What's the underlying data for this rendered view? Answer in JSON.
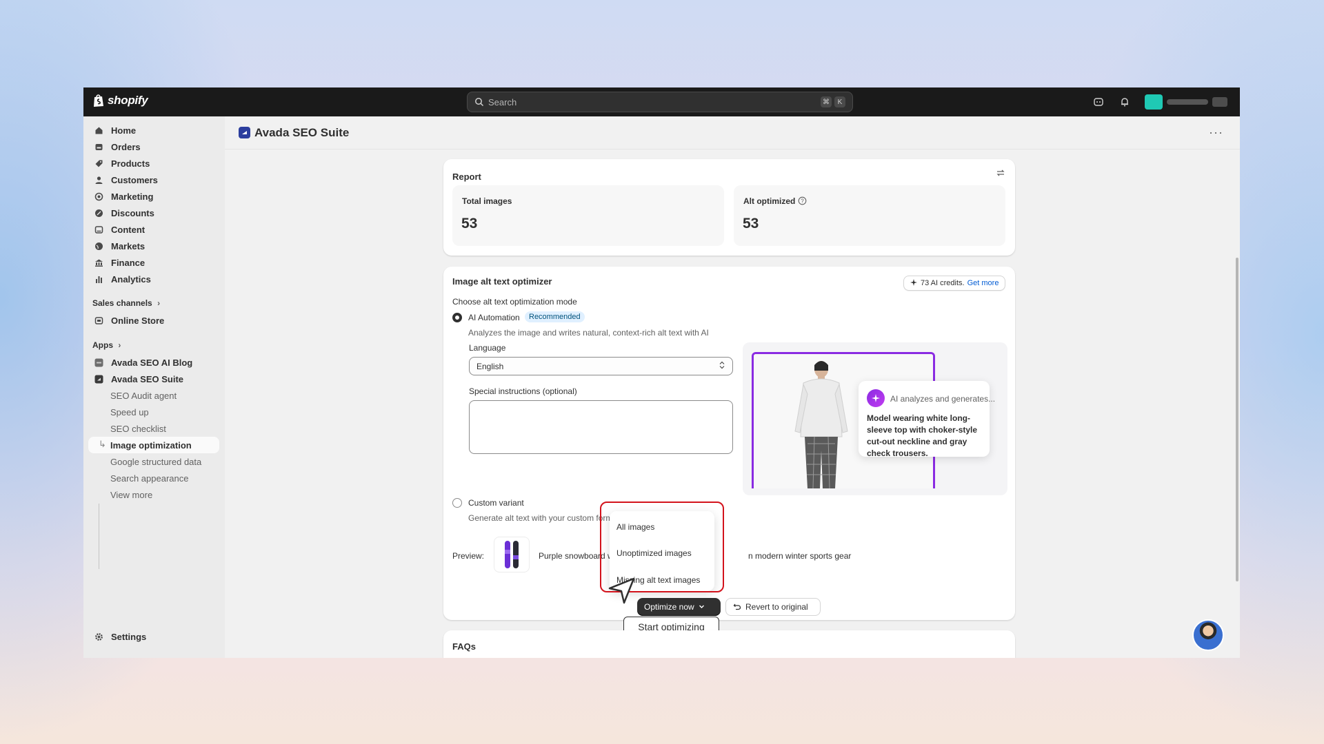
{
  "topbar": {
    "logo_text": "shopify",
    "search_placeholder": "Search",
    "kbd_cmd": "⌘",
    "kbd_key": "K"
  },
  "sidebar": {
    "items": [
      {
        "label": "Home",
        "icon": "home-icon"
      },
      {
        "label": "Orders",
        "icon": "inbox-icon"
      },
      {
        "label": "Products",
        "icon": "tag-icon"
      },
      {
        "label": "Customers",
        "icon": "person-icon"
      },
      {
        "label": "Marketing",
        "icon": "target-icon"
      },
      {
        "label": "Discounts",
        "icon": "discount-icon"
      },
      {
        "label": "Content",
        "icon": "content-icon"
      },
      {
        "label": "Markets",
        "icon": "globe-icon"
      },
      {
        "label": "Finance",
        "icon": "bank-icon"
      },
      {
        "label": "Analytics",
        "icon": "bar-chart-icon"
      }
    ],
    "sales_channels_label": "Sales channels",
    "online_store_label": "Online Store",
    "apps_label": "Apps",
    "apps": [
      {
        "label": "Avada SEO AI Blog"
      },
      {
        "label": "Avada SEO Suite"
      }
    ],
    "sub_items": [
      {
        "label": "SEO Audit agent"
      },
      {
        "label": "Speed up"
      },
      {
        "label": "SEO checklist"
      },
      {
        "label": "Image optimization"
      },
      {
        "label": "Google structured data"
      },
      {
        "label": "Search appearance"
      },
      {
        "label": "View more"
      }
    ],
    "settings_label": "Settings"
  },
  "app": {
    "title": "Avada SEO Suite",
    "more": "···"
  },
  "report": {
    "title": "Report",
    "total_images_label": "Total images",
    "total_images_value": "53",
    "alt_optimized_label": "Alt optimized",
    "alt_optimized_value": "53"
  },
  "optimizer": {
    "title": "Image alt text optimizer",
    "credits_text": "73 AI credits.",
    "get_more": "Get more",
    "mode_label": "Choose alt text optimization mode",
    "ai_label": "AI Automation",
    "recommended": "Recommended",
    "ai_desc": "Analyzes the image and writes natural, context-rich alt text with AI",
    "language_label": "Language",
    "language_value": "English",
    "instructions_label": "Special instructions (optional)",
    "ai_card_header": "AI analyzes and generates...",
    "ai_card_body": "Model wearing white long-sleeve top with choker-style cut-out neckline and gray check trousers.",
    "custom_label": "Custom variant",
    "custom_desc": "Generate alt text with your custom formula",
    "preview_label": "Preview:",
    "preview_text_a": "Purple snowboard with ge",
    "preview_text_b": "n modern winter sports gear",
    "dropdown": [
      "All images",
      "Unoptimized images",
      "Missing alt text images"
    ],
    "optimize_now": "Optimize now",
    "revert": "Revert to original",
    "tooltip": "Start optimizing"
  },
  "faqs": {
    "title": "FAQs"
  },
  "colors": {
    "accent_purple": "#8a2be2",
    "highlight_red": "#d3121b",
    "link_blue": "#005bd3"
  }
}
